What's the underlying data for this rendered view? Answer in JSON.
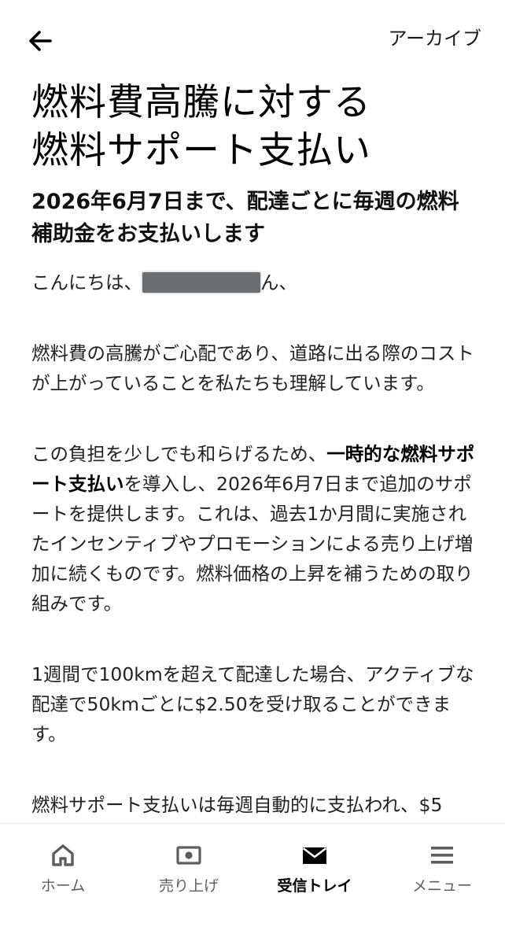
{
  "header": {
    "back_icon": "arrow-left-icon",
    "archive_label": "アーカイブ"
  },
  "article": {
    "title_line1": "燃料費高騰に対する",
    "title_line2": "燃料サポート支払い",
    "subtitle": "2026年6月7日まで、配達ごとに毎週の燃料補助金をお支払いします",
    "greeting_prefix": "こんにちは、",
    "greeting_suffix": "ん、",
    "p1": "燃料費の高騰がご心配であり、道路に出る際のコストが上がっていることを私たちも理解しています。",
    "p2_before": "この負担を少しでも和らげるため、",
    "p2_bold": "一時的な燃料サポート支払い",
    "p2_after": "を導入し、2026年6月7日まで追加のサポートを提供します。これは、過去1か月間に実施されたインセンティブやプロモーションによる売り上げ増加に続くものです。燃料価格の上昇を補うための取り組みです。",
    "p3": "1週間で100kmを超えて配達した場合、アクティブな配達で50kmごとに$2.50を受け取ることができます。",
    "p4": "燃料サポート支払いは毎週自動的に支払われ、$5"
  },
  "tabs": [
    {
      "label": "ホーム",
      "icon": "home-icon",
      "active": false
    },
    {
      "label": "売り上げ",
      "icon": "earnings-icon",
      "active": false
    },
    {
      "label": "受信トレイ",
      "icon": "inbox-icon",
      "active": true
    },
    {
      "label": "メニュー",
      "icon": "menu-icon",
      "active": false
    }
  ],
  "colors": {
    "text": "#000000",
    "inactive_tab": "#5e5e5e",
    "redaction": "#6b6d70"
  }
}
